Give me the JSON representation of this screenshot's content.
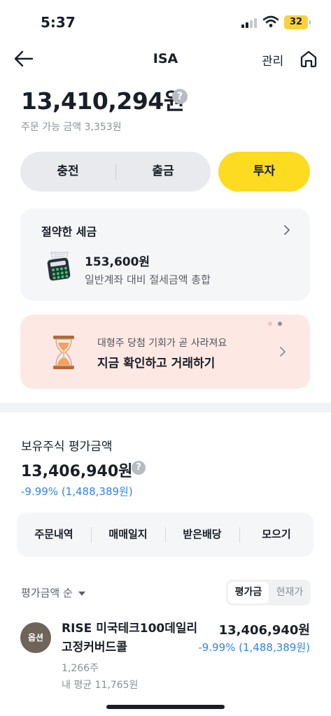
{
  "status_bar": {
    "time": "5:37",
    "battery": "32"
  },
  "nav": {
    "title": "ISA",
    "manage_label": "관리"
  },
  "account": {
    "balance": "13,410,294원",
    "orderable_label": "주문 가능 금액 3,353원",
    "help_glyph": "?"
  },
  "actions": {
    "deposit": "충전",
    "withdraw": "출금",
    "invest": "투자"
  },
  "tax_card": {
    "title": "절약한 세금",
    "amount": "153,600원",
    "description": "일반계좌 대비 절세금액 총합",
    "icon": "calculator-icon"
  },
  "promo": {
    "small_text": "대형주 당첨 기회가 곧 사라져요",
    "main_text": "지금 확인하고 거래하기",
    "icon": "hourglass-icon",
    "page_count": 2,
    "active_page": 2
  },
  "holdings": {
    "label": "보유주식 평가금액",
    "value": "13,406,940원",
    "change": "-9.99% (1,488,389원)"
  },
  "tabs": [
    {
      "label": "주문내역"
    },
    {
      "label": "매매일지"
    },
    {
      "label": "받은배당"
    },
    {
      "label": "모으기"
    }
  ],
  "list_controls": {
    "sort_label": "평가금액 순",
    "toggle": {
      "active": "평가금",
      "inactive": "현재가"
    }
  },
  "stocks": [
    {
      "badge": "옵션",
      "name": "RISE 미국테크100데일리고정커버드콜",
      "quantity": "1,266주",
      "avg_price": "내 평균 11,765원",
      "value": "13,406,940원",
      "change": "-9.99% (1,488,389원)"
    }
  ],
  "colors": {
    "accent_yellow": "#fcdb21",
    "negative_blue": "#3182f6",
    "promo_bg": "#fde8e3",
    "card_bg": "#f5f6f8",
    "badge_brown": "#6e6459"
  }
}
